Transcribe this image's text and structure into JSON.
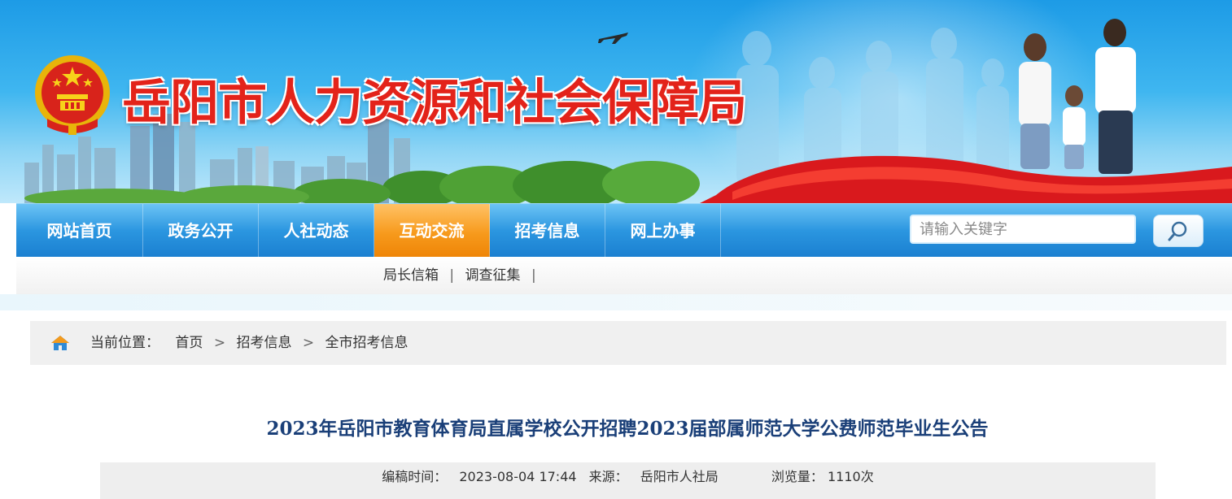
{
  "header": {
    "site_title": "岳阳市人力资源和社会保障局"
  },
  "nav": {
    "items": [
      {
        "label": "网站首页"
      },
      {
        "label": "政务公开"
      },
      {
        "label": "人社动态"
      },
      {
        "label": "互动交流",
        "active": true
      },
      {
        "label": "招考信息"
      },
      {
        "label": "网上办事"
      }
    ],
    "search_placeholder": "请输入关键字"
  },
  "subnav": {
    "items": [
      {
        "label": "局长信箱"
      },
      {
        "label": "调查征集"
      }
    ],
    "separator": "|"
  },
  "breadcrumb": {
    "label": "当前位置：",
    "items": [
      {
        "label": "首页"
      },
      {
        "label": "招考信息"
      },
      {
        "label": "全市招考信息"
      }
    ],
    "separator": ">"
  },
  "article": {
    "title": "2023年岳阳市教育体育局直属学校公开招聘2023届部属师范大学公费师范毕业生公告",
    "meta": {
      "edit_time_label": "编稿时间：",
      "edit_time": "2023-08-04 17:44",
      "source_label": "来源：",
      "source": "岳阳市人社局",
      "views_label": "浏览量：",
      "views": "1110次"
    }
  },
  "colors": {
    "nav_blue": "#2b96e0",
    "nav_active": "#f79a1c",
    "title_red": "#e3231a",
    "article_title": "#1a3f78"
  },
  "icons": [
    "national-emblem-icon",
    "airplane-icon",
    "search-icon",
    "home-icon"
  ]
}
